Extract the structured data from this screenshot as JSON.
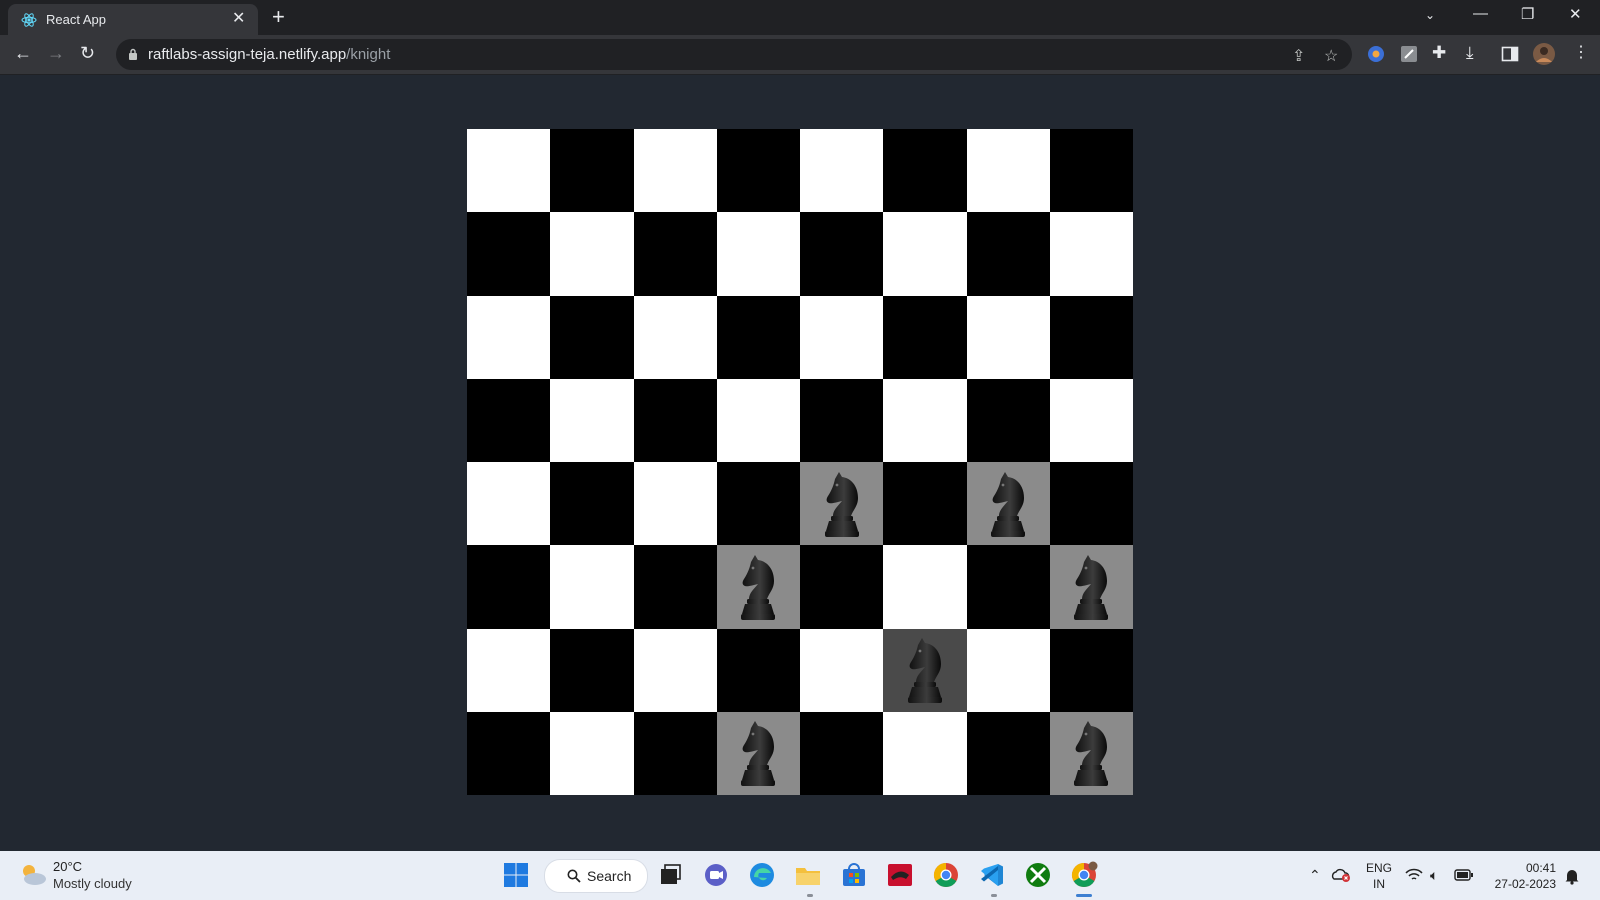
{
  "browser": {
    "tab_title": "React App",
    "url_host": "raftlabs-assign-teja.netlify.app",
    "url_path": "/knight"
  },
  "board": {
    "size": 8,
    "light_color": "#ffffff",
    "dark_color": "#000000",
    "highlight_color": "#8b8b8b",
    "selected_color": "#4a4a4a",
    "selected_knight": {
      "row": 6,
      "col": 5
    },
    "knight_moves": [
      {
        "row": 4,
        "col": 4
      },
      {
        "row": 4,
        "col": 6
      },
      {
        "row": 5,
        "col": 3
      },
      {
        "row": 5,
        "col": 7
      },
      {
        "row": 7,
        "col": 3
      },
      {
        "row": 7,
        "col": 7
      }
    ],
    "piece_icon": "knight-icon"
  },
  "taskbar": {
    "weather_temp": "20°C",
    "weather_desc": "Mostly cloudy",
    "search_label": "Search",
    "lang_top": "ENG",
    "lang_bottom": "IN",
    "time": "00:41",
    "date": "27-02-2023"
  }
}
